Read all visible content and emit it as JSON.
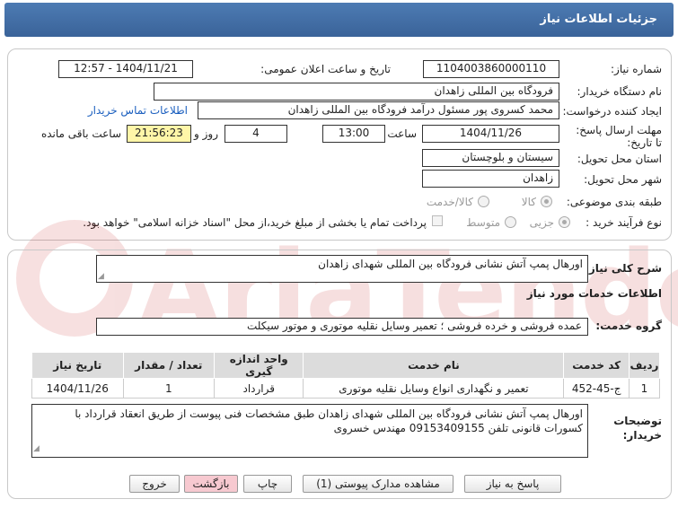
{
  "header": {
    "title": "جزئیات اطلاعات نیاز"
  },
  "form": {
    "need_number_label": "شماره نیاز:",
    "need_number": "1104003860000110",
    "announce_label": "تاریخ و ساعت اعلان عمومی:",
    "announce_value": "1404/11/21 - 12:57",
    "buyer_label": "نام دستگاه خریدار:",
    "buyer_value": "فرودگاه بین المللی زاهدان",
    "creator_label": "ایجاد کننده درخواست:",
    "creator_value": "محمد کسروی پور مسئول درآمد فرودگاه بین المللی زاهدان",
    "contact_link": "اطلاعات تماس خریدار",
    "deadline_label": "مهلت ارسال پاسخ: تا تاریخ:",
    "deadline_date": "1404/11/26",
    "time_label": "ساعت",
    "deadline_time": "13:00",
    "days_value": "4",
    "days_label": "روز و",
    "remaining_time": "21:56:23",
    "remaining_label": "ساعت باقی مانده",
    "province_label": "استان محل تحویل:",
    "province_value": "سیستان و بلوچستان",
    "city_label": "شهر محل تحویل:",
    "city_value": "زاهدان",
    "category_label": "طبقه بندی موضوعی:",
    "category_opt1": "کالا",
    "category_opt2": "کالا/خدمت",
    "process_label": "نوع فرآیند خرید :",
    "process_opt1": "جزیی",
    "process_opt2": "متوسط",
    "payment_note": "پرداخت تمام یا بخشی از مبلغ خرید،از محل \"اسناد خزانه اسلامی\" خواهد بود."
  },
  "details": {
    "summary_label": "شرح کلی نیاز:",
    "summary_value": "اورهال پمپ آتش نشانی فرودگاه بین المللی شهدای زاهدان",
    "services_heading": "اطلاعات خدمات مورد نیاز",
    "group_label": "گروه خدمت:",
    "group_value": "عمده فروشی و خرده فروشی ؛ تعمیر وسایل نقلیه موتوری و موتور سیکلت",
    "table": {
      "headers": [
        "ردیف",
        "کد خدمت",
        "نام خدمت",
        "واحد اندازه گیری",
        "تعداد / مقدار",
        "تاریخ نیاز"
      ],
      "rows": [
        [
          "1",
          "ج-45-452",
          "تعمیر و نگهداری انواع وسایل نقلیه موتوری",
          "قرارداد",
          "1",
          "1404/11/26"
        ]
      ]
    },
    "buyer_notes_label": "توضیحات خریدار:",
    "buyer_notes": "اورهال پمپ آتش نشانی فرودگاه بین المللی شهدای زاهدان طبق مشخصات فنی پیوست از طریق انعقاد قرارداد با کسورات قانونی تلفن 09153409155 مهندس خسروی"
  },
  "buttons": {
    "reply": "پاسخ به نیاز",
    "attachments": "مشاهده مدارک پیوستی (1)",
    "print": "چاپ",
    "back": "بازگشت",
    "exit": "خروج"
  },
  "watermark": "AriaTender.net"
}
